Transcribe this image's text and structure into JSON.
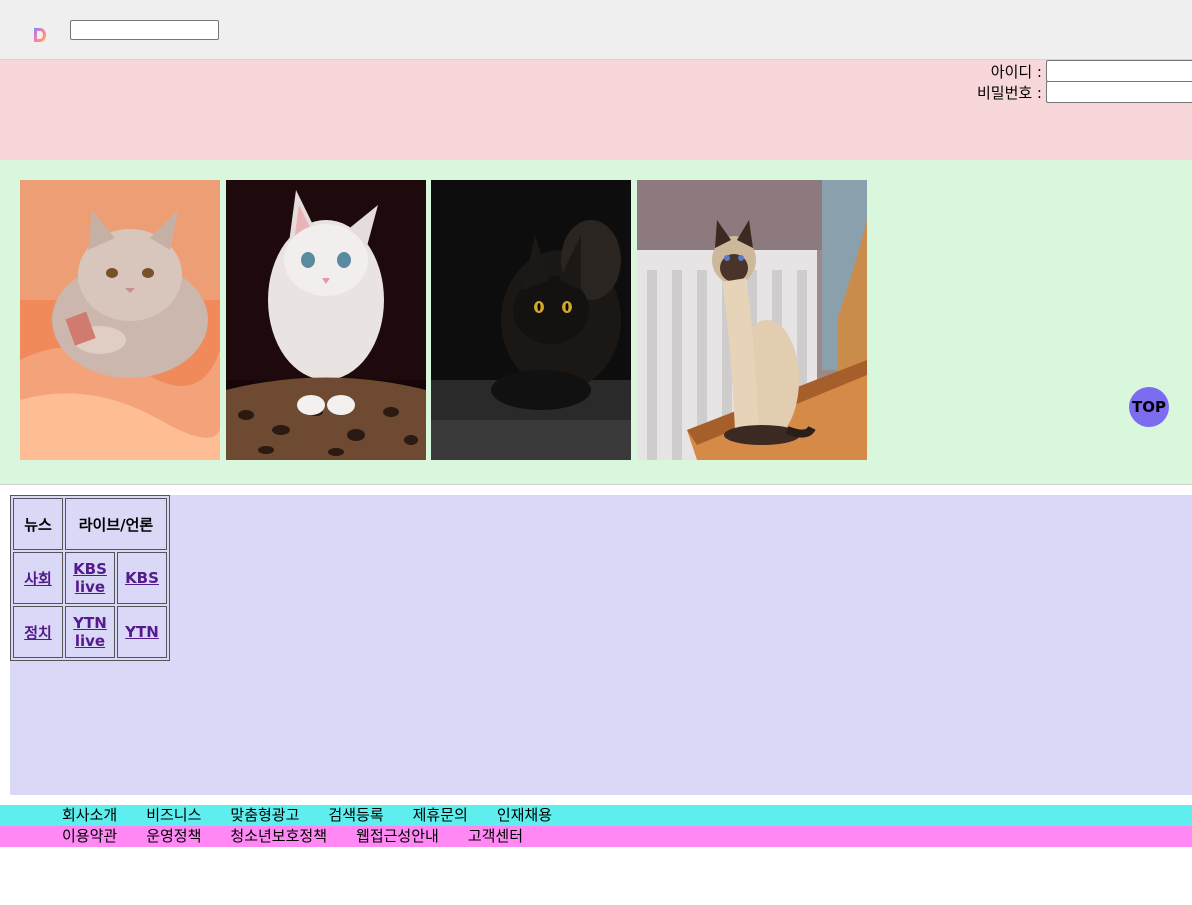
{
  "header": {
    "logo_letter": "D",
    "search": {
      "value": "",
      "placeholder": ""
    }
  },
  "login": {
    "id_label": "아이디 :",
    "pw_label": "비밀번호 :"
  },
  "gallery": {
    "images": [
      {
        "name": "cat-photo-fluffy-gray"
      },
      {
        "name": "cat-photo-white-kitten"
      },
      {
        "name": "cat-photo-black"
      },
      {
        "name": "cat-photo-siamese"
      }
    ],
    "top_button": "TOP"
  },
  "news_table": {
    "headers": [
      "뉴스",
      "라이브/언론"
    ],
    "rows": [
      [
        "사회",
        "KBS live",
        "KBS"
      ],
      [
        "정치",
        "YTN live",
        "YTN"
      ]
    ]
  },
  "footer": {
    "row1": [
      "회사소개",
      "비즈니스",
      "맞춤형광고",
      "검색등록",
      "제휴문의",
      "인재채용"
    ],
    "row2": [
      "이용약관",
      "운영정책",
      "청소년보호정책",
      "웹접근성안내",
      "고객센터"
    ]
  }
}
